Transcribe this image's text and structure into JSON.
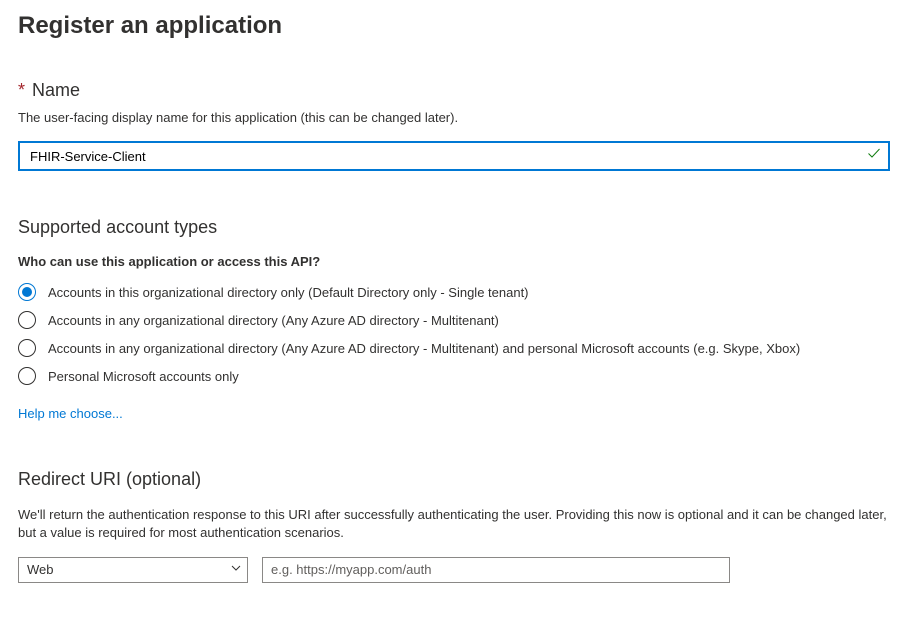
{
  "page_title": "Register an application",
  "name_field": {
    "label": "Name",
    "description": "The user-facing display name for this application (this can be changed later).",
    "value": "FHIR-Service-Client"
  },
  "account_types": {
    "heading": "Supported account types",
    "subheading": "Who can use this application or access this API?",
    "options": [
      "Accounts in this organizational directory only (Default Directory only - Single tenant)",
      "Accounts in any organizational directory (Any Azure AD directory - Multitenant)",
      "Accounts in any organizational directory (Any Azure AD directory - Multitenant) and personal Microsoft accounts (e.g. Skype, Xbox)",
      "Personal Microsoft accounts only"
    ],
    "selected_index": 0,
    "help_link": "Help me choose..."
  },
  "redirect_uri": {
    "heading": "Redirect URI (optional)",
    "description": "We'll return the authentication response to this URI after successfully authenticating the user. Providing this now is optional and it can be changed later, but a value is required for most authentication scenarios.",
    "platform_selected": "Web",
    "placeholder": "e.g. https://myapp.com/auth",
    "value": ""
  }
}
